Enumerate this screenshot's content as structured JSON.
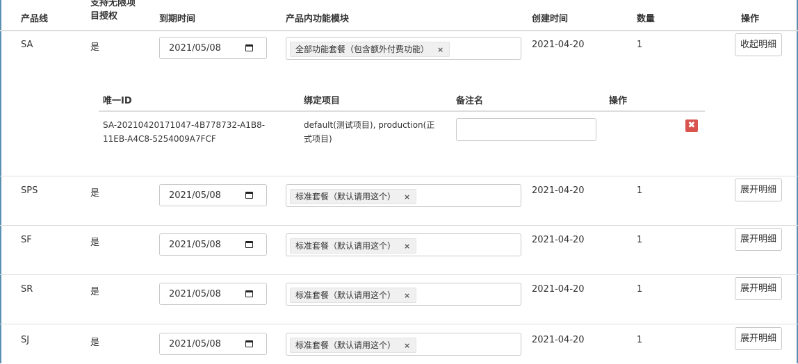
{
  "columns": {
    "product_line": "产品线",
    "unlimited_line1": "支持无限项",
    "unlimited_line2": "目授权",
    "expire": "到期时间",
    "modules": "产品内功能模块",
    "created": "创建时间",
    "quantity": "数量",
    "action": "操作"
  },
  "rows": [
    {
      "product": "SA",
      "unlimited": "是",
      "expire_date": "2021/05/08",
      "module_tag": "全部功能套餐（包含额外付费功能）",
      "created": "2021-04-20",
      "quantity": "1",
      "button": "收起明细"
    },
    {
      "product": "SPS",
      "unlimited": "是",
      "expire_date": "2021/05/08",
      "module_tag": "标准套餐（默认请用这个）",
      "created": "2021-04-20",
      "quantity": "1",
      "button": "展开明细"
    },
    {
      "product": "SF",
      "unlimited": "是",
      "expire_date": "2021/05/08",
      "module_tag": "标准套餐（默认请用这个）",
      "created": "2021-04-20",
      "quantity": "1",
      "button": "展开明细"
    },
    {
      "product": "SR",
      "unlimited": "是",
      "expire_date": "2021/05/08",
      "module_tag": "标准套餐（默认请用这个）",
      "created": "2021-04-20",
      "quantity": "1",
      "button": "展开明细"
    },
    {
      "product": "SJ",
      "unlimited": "是",
      "expire_date": "2021/05/08",
      "module_tag": "标准套餐（默认请用这个）",
      "created": "2021-04-20",
      "quantity": "1",
      "button": "展开明细"
    }
  ],
  "tag_remove": "×",
  "detail": {
    "columns": {
      "uid": "唯一ID",
      "project": "绑定项目",
      "remark": "备注名",
      "action": "操作"
    },
    "uid_line1": "SA-20210420171047-4B778732-A1B8-",
    "uid_line2": "11EB-A4C8-5254009A7FCF",
    "project_line1": "default(测试项目), production(正",
    "project_line2": "式项目)",
    "remark_value": "",
    "delete_glyph": "✖"
  },
  "colors": {
    "frame": "#5b8fb0",
    "delete": "#d9534f",
    "tag_bg": "#f0f0f0"
  }
}
